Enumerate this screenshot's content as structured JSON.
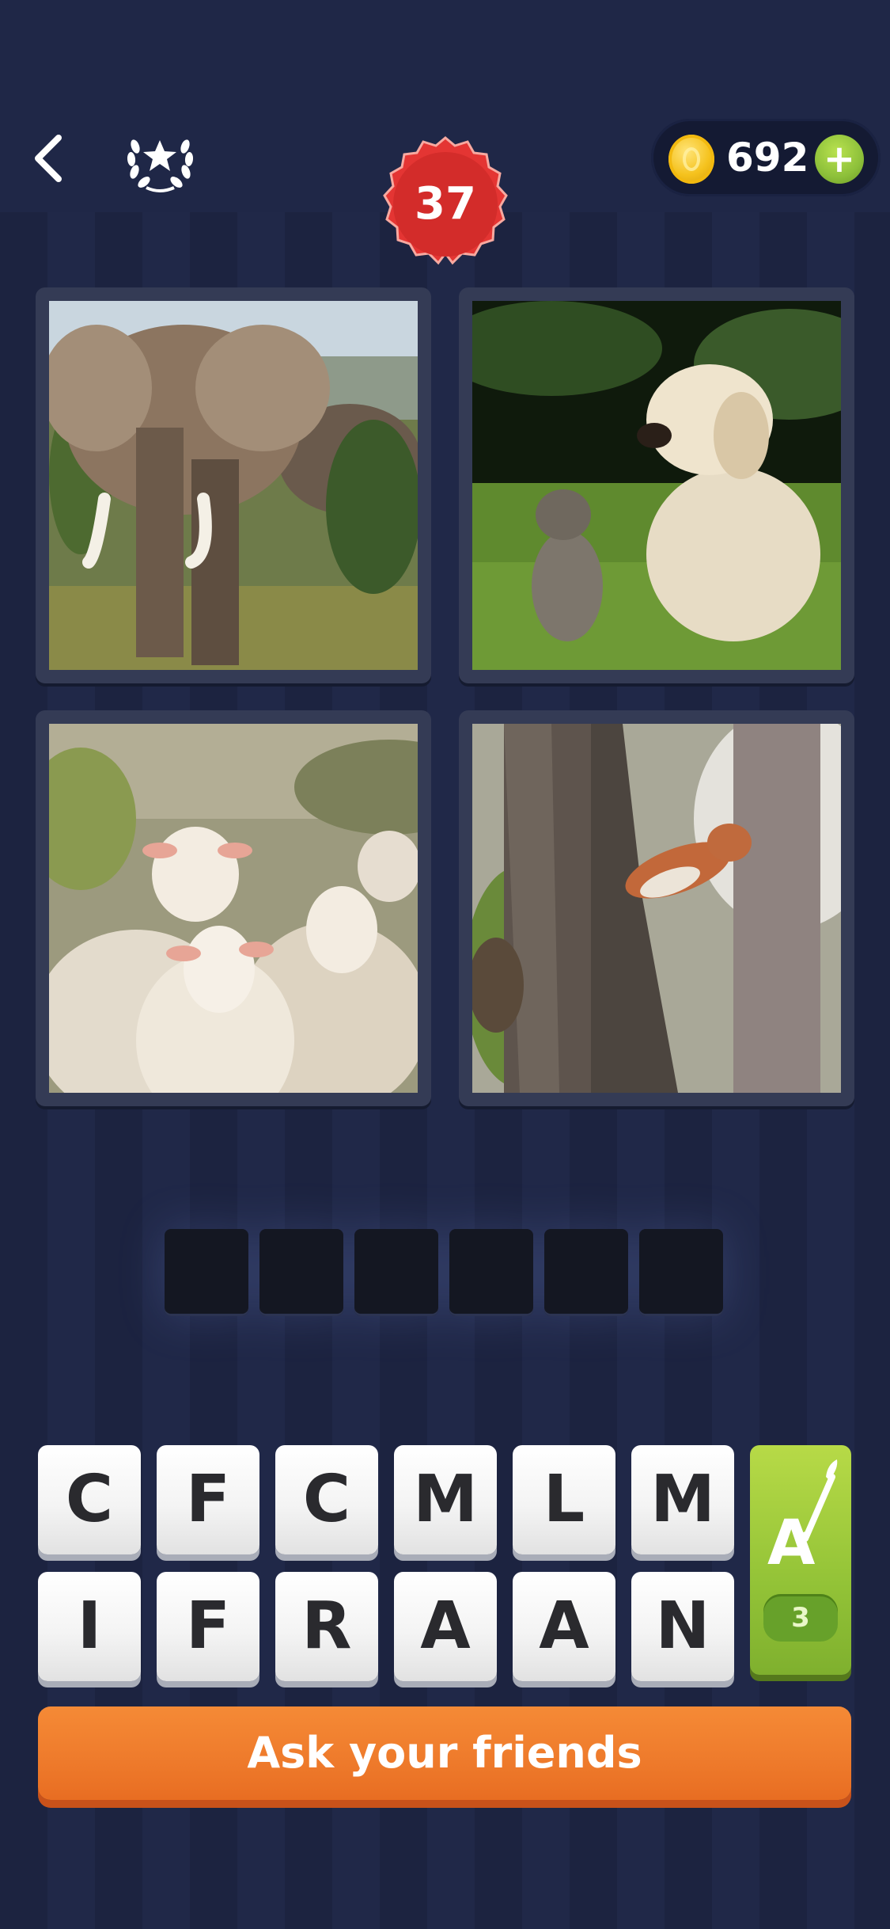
{
  "header": {
    "back_icon": "chevron-left-icon",
    "achievements_icon": "laurel-star-icon",
    "coins": "692",
    "add_coins_label": "+",
    "level": "37"
  },
  "puzzle": {
    "images": [
      {
        "subject": "elephant"
      },
      {
        "subject": "puppy-and-kitten"
      },
      {
        "subject": "sheep"
      },
      {
        "subject": "squirrel"
      }
    ],
    "answer_slots": [
      "",
      "",
      "",
      "",
      "",
      ""
    ]
  },
  "letters": {
    "row1": [
      "C",
      "F",
      "C",
      "M",
      "L",
      "M"
    ],
    "row2": [
      "I",
      "F",
      "R",
      "A",
      "A",
      "N"
    ]
  },
  "hint": {
    "icon": "paintbrush-letter-a-icon",
    "letter": "A",
    "count": "3"
  },
  "ask_button": {
    "label": "Ask your friends"
  },
  "colors": {
    "background": "#1d2441",
    "level_badge": "#e43533",
    "hint_button": "#93c337",
    "ask_button": "#ee7a2b"
  }
}
